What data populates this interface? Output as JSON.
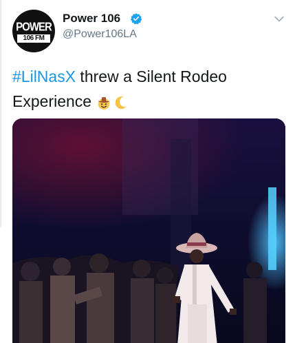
{
  "account": {
    "display_name": "Power 106",
    "handle": "@Power106LA",
    "avatar_text_top": "POWER",
    "avatar_text_bottom": "106 FM"
  },
  "tweet": {
    "hashtag": "#LilNasX",
    "text_line1": " threw a Silent Rodeo",
    "text_line2": "Experience "
  },
  "icons": {
    "verified": "verified-badge-icon",
    "menu": "chevron-down-icon",
    "emoji_1": "cowboy-hat-face-icon",
    "emoji_2": "crescent-moon-icon"
  },
  "colors": {
    "accent": "#1b95e0",
    "text": "#14171a",
    "muted": "#657786"
  }
}
